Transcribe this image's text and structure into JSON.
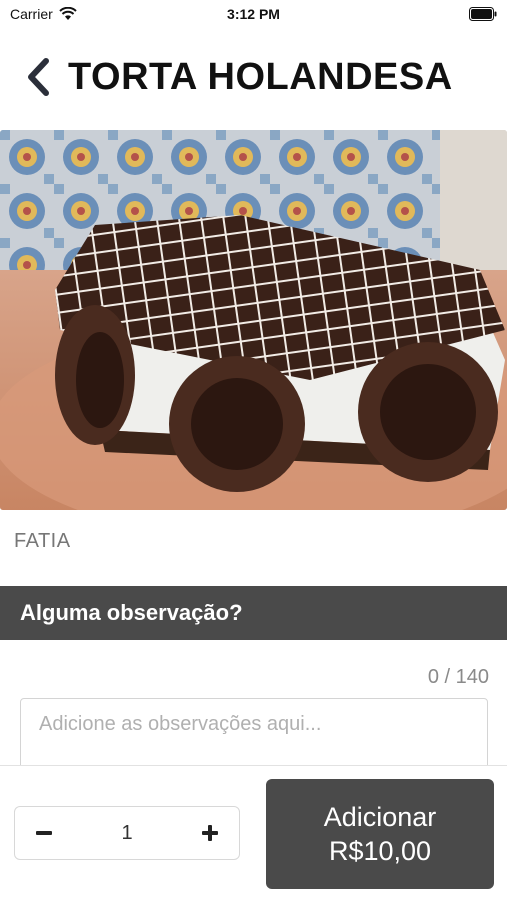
{
  "status_bar": {
    "carrier": "Carrier",
    "time": "3:12 PM",
    "icons": [
      "wifi-icon",
      "battery-icon"
    ]
  },
  "header": {
    "title": "TORTA HOLANDESA",
    "back_icon": "chevron-left-icon"
  },
  "product": {
    "image": "cake-photo",
    "description": "FATIA"
  },
  "observations": {
    "title": "Alguma observação?",
    "counter": "0 / 140",
    "placeholder": "Adicione as observações aqui...",
    "value": ""
  },
  "footer": {
    "quantity": "1",
    "minus_icon": "minus-icon",
    "plus_icon": "plus-icon",
    "add_label": "Adicionar",
    "price": "R$10,00"
  },
  "colors": {
    "primary_dark": "#4a4a4a",
    "background": "#ffffff",
    "muted_text": "#777777"
  }
}
